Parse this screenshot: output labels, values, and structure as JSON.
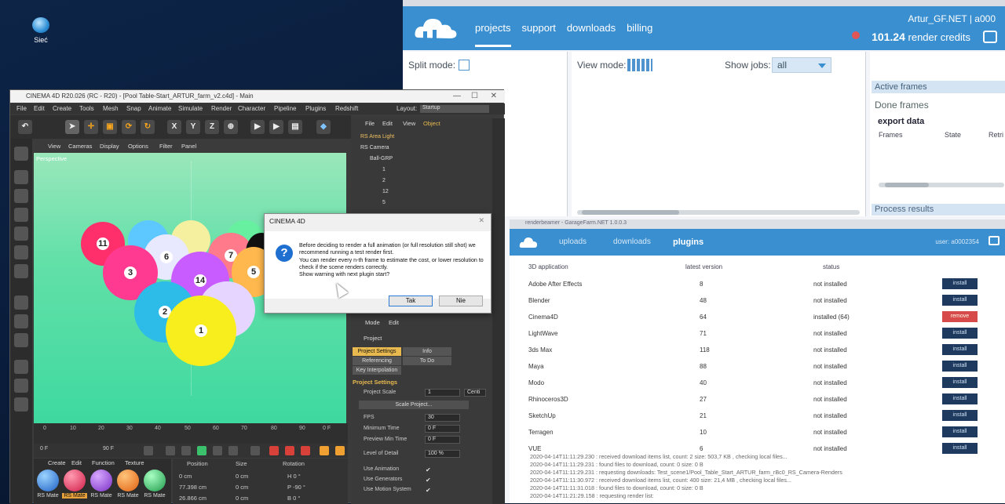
{
  "desktop": {
    "icon_label": "Sieć"
  },
  "portal": {
    "nav": [
      "projects",
      "support",
      "downloads",
      "billing"
    ],
    "user": "Artur_GF.NET | a000",
    "credits_value": "101.24",
    "credits_label": "render credits",
    "split_mode": "Split mode:",
    "view_mode": "View mode:",
    "show_jobs": "Show jobs:",
    "show_jobs_value": "all",
    "active_frames": "Active frames",
    "done_frames": "Done frames",
    "export_data": "export data",
    "cols": [
      "Frames",
      "State",
      "Retri"
    ],
    "process_results": "Process results"
  },
  "plugins": {
    "title": "renderbeamer - GarageFarm.NET 1.0.0.3",
    "tabs": [
      "uploads",
      "downloads",
      "plugins"
    ],
    "user": "user: a0002354",
    "headers": [
      "3D application",
      "latest version",
      "status"
    ],
    "rows": [
      {
        "app": "Adobe After Effects",
        "ver": "8",
        "status": "not installed",
        "action": "install"
      },
      {
        "app": "Blender",
        "ver": "48",
        "status": "not installed",
        "action": "install"
      },
      {
        "app": "Cinema4D",
        "ver": "64",
        "status": "installed (64)",
        "action": "remove"
      },
      {
        "app": "LightWave",
        "ver": "71",
        "status": "not installed",
        "action": "install"
      },
      {
        "app": "3ds Max",
        "ver": "118",
        "status": "not installed",
        "action": "install"
      },
      {
        "app": "Maya",
        "ver": "88",
        "status": "not installed",
        "action": "install"
      },
      {
        "app": "Modo",
        "ver": "40",
        "status": "not installed",
        "action": "install"
      },
      {
        "app": "Rhinoceros3D",
        "ver": "27",
        "status": "not installed",
        "action": "install"
      },
      {
        "app": "SketchUp",
        "ver": "21",
        "status": "not installed",
        "action": "install"
      },
      {
        "app": "Terragen",
        "ver": "10",
        "status": "not installed",
        "action": "install"
      },
      {
        "app": "VUE",
        "ver": "6",
        "status": "not installed",
        "action": "install"
      }
    ],
    "log": [
      "2020-04-14T11:11:29.230 : received download items list, count: 2 size: 503,7 KB , checking local files...",
      "2020-04-14T11:11:29.231 : found files to download, count: 0 size: 0 B",
      "2020-04-14T11:11:29.231 : requesting downloads: Test_scene1/Pool_Table_Start_ARTUR_farm_rBc0_RS_Camera-Renders",
      "2020-04-14T11:11:30.972 : received download items list, count: 400 size: 21,4 MB , checking local files...",
      "2020-04-14T11:11:31.018 : found files to download, count: 0 size: 0 B",
      "2020-04-14T11:21:29.158 : requesting render list:"
    ]
  },
  "c4d": {
    "title": "CINEMA 4D R20.026 (RC - R20) - [Pool Table-Start_ARTUR_farm_v2.c4d] - Main",
    "menu": [
      "File",
      "Edit",
      "Create",
      "Tools",
      "Mesh",
      "Snap",
      "Animate",
      "Simulate",
      "Render",
      "Character",
      "Pipeline",
      "Plugins",
      "Redshift"
    ],
    "layout_label": "Layout:",
    "layout_value": "Startup",
    "vp_menu": [
      "View",
      "Cameras",
      "Display",
      "Options",
      "Filter",
      "Panel"
    ],
    "vp_label": "Perspective",
    "obj_menu": [
      "File",
      "Edit",
      "View",
      "Object"
    ],
    "objects": [
      "RS Area Light",
      "RS Camera",
      "Ball-GRP",
      "1",
      "2",
      "12",
      "5"
    ],
    "timeline": [
      "0",
      "10",
      "20",
      "30",
      "40",
      "50",
      "60",
      "70",
      "80",
      "90",
      "0 F"
    ],
    "frame_fields": [
      "0 F",
      "90 F"
    ],
    "mat_menu": [
      "Create",
      "Edit",
      "Function",
      "Texture"
    ],
    "mats": [
      "RS Mate",
      "RS Mate",
      "RS Mate",
      "RS Mate",
      "RS Mate"
    ],
    "coord_heads": [
      "Position",
      "Size",
      "Rotation"
    ],
    "coords": [
      "0 cm",
      "77.398 cm",
      "26.866 cm",
      "0 cm",
      "0 cm",
      "0 cm",
      "H 0 °",
      "P -90 °",
      "B 0 °"
    ],
    "attr_menu": [
      "Mode",
      "Edit"
    ],
    "attr_tabs": [
      "Project",
      "Project Settings",
      "Info",
      "Referencing",
      "To Do",
      "Key Interpolation"
    ],
    "proj_settings": "Project Settings",
    "proj_scale": "Project Scale",
    "proj_scale_val": "1",
    "proj_scale_unit": "Centi",
    "scale_btn": "Scale Project...",
    "fields": [
      {
        "k": "FPS",
        "v": "30"
      },
      {
        "k": "Minimum Time",
        "v": "0 F"
      },
      {
        "k": "Preview Min Time",
        "v": "0 F"
      },
      {
        "k": "Level of Detail",
        "v": "100 %"
      }
    ],
    "checks": [
      "Use Animation",
      "Use Generators",
      "Use Motion System"
    ]
  },
  "dialog": {
    "title": "CINEMA 4D",
    "text": "Before deciding to render a full animation (or full resolution still shot) we recommend running a test render first.\nYou can render every n-th frame to estimate the cost, or lower resolution to check if the scene renders correctly.\n Show warning with next plugin start?",
    "yes": "Tak",
    "no": "Nie"
  },
  "balls": [
    "11",
    "6",
    "7",
    "3",
    "14",
    "5",
    "2",
    "1"
  ]
}
